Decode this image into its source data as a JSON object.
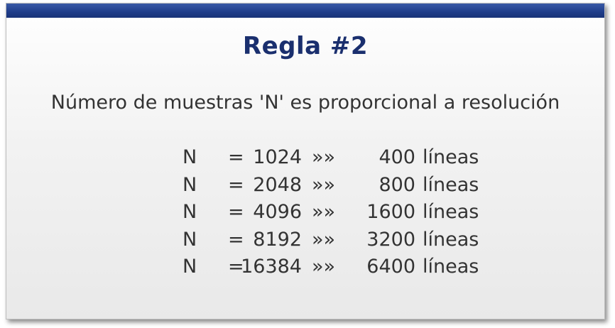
{
  "slide": {
    "title": "Regla #2",
    "subtitle": "Número de muestras 'N' es proporcional a resolución",
    "rows": [
      {
        "label": "N",
        "eq": "=",
        "samples": "1024",
        "arrow": "»»",
        "lines": "400",
        "unit": "líneas"
      },
      {
        "label": "N",
        "eq": "=",
        "samples": "2048",
        "arrow": "»»",
        "lines": "800",
        "unit": "líneas"
      },
      {
        "label": "N",
        "eq": "=",
        "samples": "4096",
        "arrow": "»»",
        "lines": "1600",
        "unit": "líneas"
      },
      {
        "label": "N",
        "eq": "=",
        "samples": "8192",
        "arrow": "»»",
        "lines": "3200",
        "unit": "líneas"
      },
      {
        "label": "N",
        "eq": "=",
        "samples": "16384",
        "arrow": "»»",
        "lines": "6400",
        "unit": "líneas"
      }
    ]
  },
  "colors": {
    "bar": "#1f3d8a",
    "title": "#1a2f6e",
    "text": "#333333"
  }
}
